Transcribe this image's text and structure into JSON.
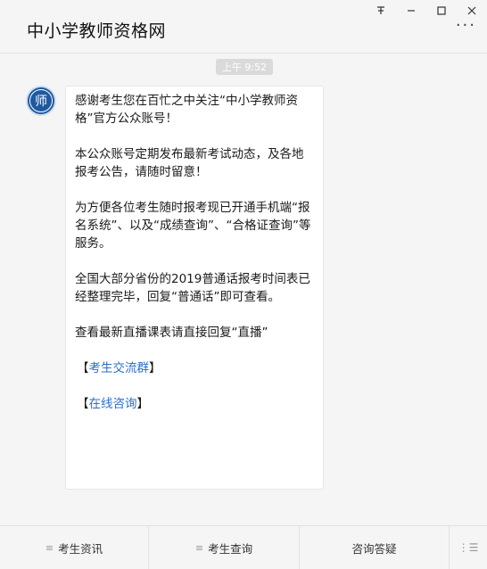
{
  "window": {
    "pin_icon": "pin-icon",
    "minimize_icon": "minimize-icon",
    "maximize_icon": "maximize-icon",
    "close_icon": "close-icon"
  },
  "header": {
    "title": "中小学教师资格网",
    "more_glyph": "···"
  },
  "chat": {
    "timestamp": "上午 9:52",
    "avatar_char": "师",
    "message": {
      "paragraphs": [
        "感谢考生您在百忙之中关注“中小学教师资格”官方公众账号！",
        "本公众账号定期发布最新考试动态，及各地报考公告，请随时留意！",
        "为方便各位考生随时报考现已开通手机端“报名系统”、以及“成绩查询”、“合格证查询”等服务。",
        "全国大部分省份的2019普通话报考时间表已经整理完毕，回复“普通话”即可查看。",
        "查看最新直播课表请直接回复“直播”"
      ],
      "links": [
        {
          "open": "【",
          "text": "考生交流群",
          "close": "】"
        },
        {
          "open": "【",
          "text": "在线咨询",
          "close": "】"
        }
      ]
    }
  },
  "menu": {
    "items": [
      {
        "icon": "≡",
        "label": "考生资讯"
      },
      {
        "icon": "≡",
        "label": "考生查询"
      },
      {
        "icon": "",
        "label": "咨询答疑"
      }
    ],
    "toggle_glyph": "⋮☰"
  },
  "colors": {
    "link": "#2a6fc9",
    "avatar_bg": "#1e5aa0",
    "background": "#f5f5f5"
  }
}
